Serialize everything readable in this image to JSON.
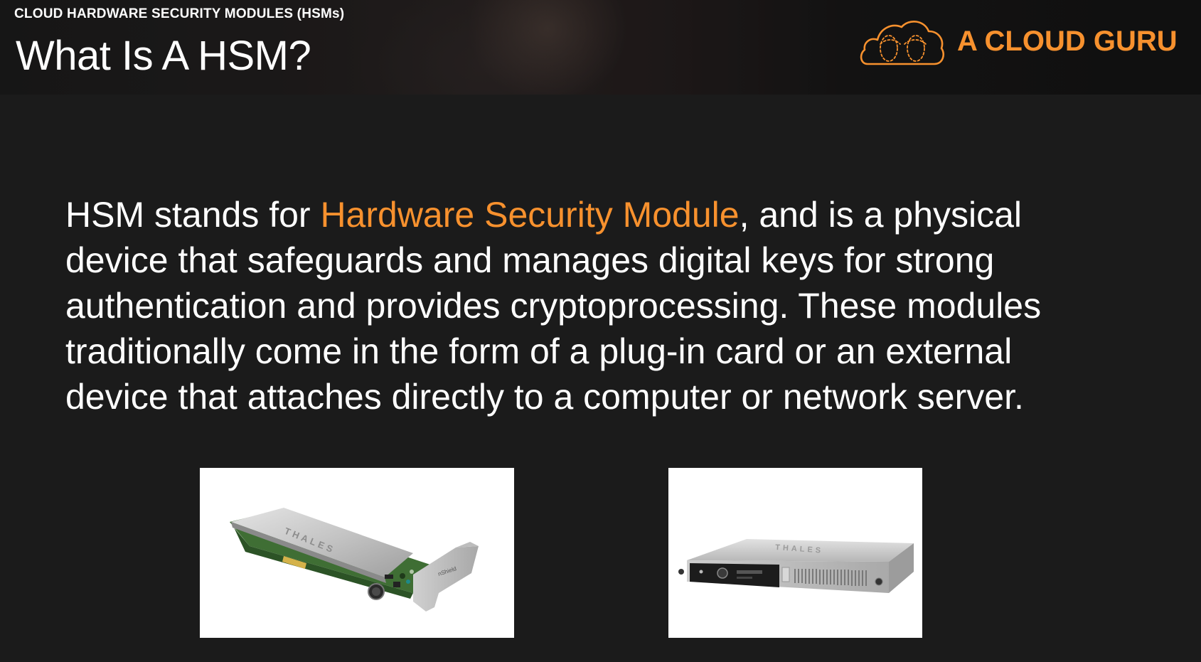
{
  "header": {
    "section_title": "CLOUD HARDWARE SECURITY MODULES (HSMs)",
    "slide_title": "What Is A HSM?"
  },
  "logo": {
    "text": "A CLOUD GURU",
    "icon": "cloud-logo-icon",
    "color": "#f7912e"
  },
  "body": {
    "line1_before": "HSM stands for ",
    "line1_highlight": "Hardware Security Module",
    "line1_after": ", and is a physical",
    "line2": "device that safeguards and manages digital keys for strong",
    "line3": "authentication and provides cryptoprocessing. These modules",
    "line4": "traditionally come in the form of a plug-in card or an external",
    "line5": "device that attaches directly to a computer or network server."
  },
  "images": {
    "card": {
      "brand_text": "THALES",
      "bracket_text": "nShield"
    },
    "server": {
      "brand_text": "THALES"
    }
  },
  "colors": {
    "accent": "#f7912e",
    "background": "#1b1b1b",
    "text": "#ffffff"
  }
}
